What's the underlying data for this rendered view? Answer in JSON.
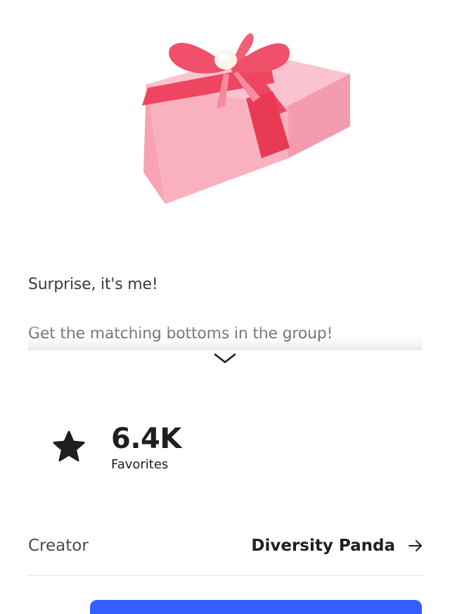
{
  "item": {
    "thumbnail_icon": "gift-box",
    "description": {
      "line1": "Surprise, it's me!",
      "line2": "Get the matching bottoms in the group!"
    },
    "expand_icon": "chevron-down-icon"
  },
  "favorites": {
    "icon": "star-icon",
    "count": "6.4K",
    "label": "Favorites"
  },
  "creator": {
    "label": "Creator",
    "name": "Diversity Panda",
    "arrow_icon": "arrow-right-icon"
  },
  "colors": {
    "primary_button": "#335fff",
    "text": "#1f1f23",
    "gift_pink": "#f7a9b8",
    "ribbon_red": "#ee4660"
  }
}
